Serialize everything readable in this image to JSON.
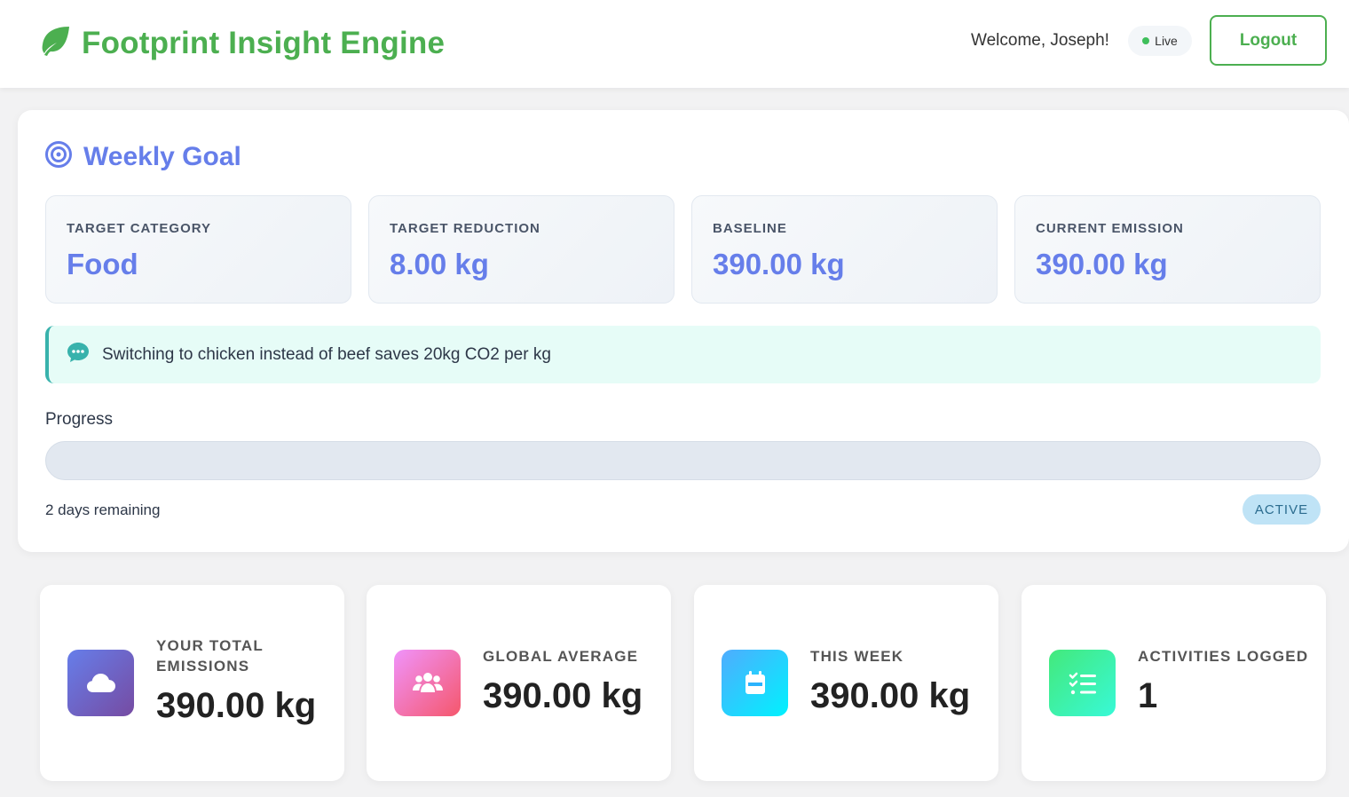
{
  "header": {
    "title": "Footprint Insight Engine",
    "welcome": "Welcome, Joseph!",
    "live_label": "Live",
    "logout_label": "Logout"
  },
  "goal": {
    "title": "Weekly Goal",
    "metrics": [
      {
        "label": "TARGET CATEGORY",
        "value": "Food"
      },
      {
        "label": "TARGET REDUCTION",
        "value": "8.00 kg"
      },
      {
        "label": "BASELINE",
        "value": "390.00 kg"
      },
      {
        "label": "CURRENT EMISSION",
        "value": "390.00 kg"
      }
    ],
    "tip": "Switching to chicken instead of beef saves 20kg CO2 per kg",
    "progress_label": "Progress",
    "progress_percent": 0,
    "days_remaining": "2 days remaining",
    "status": "ACTIVE"
  },
  "stats": [
    {
      "label": "YOUR TOTAL EMISSIONS",
      "value": "390.00 kg",
      "icon": "cloud-icon"
    },
    {
      "label": "GLOBAL AVERAGE",
      "value": "390.00 kg",
      "icon": "users-icon"
    },
    {
      "label": "THIS WEEK",
      "value": "390.00 kg",
      "icon": "calendar-icon"
    },
    {
      "label": "ACTIVITIES LOGGED",
      "value": "1",
      "icon": "checklist-icon"
    }
  ],
  "colors": {
    "brand": "#4caf50",
    "accent": "#667eea",
    "tip_border": "#38b2ac",
    "live_dot": "#3fbf5b"
  }
}
